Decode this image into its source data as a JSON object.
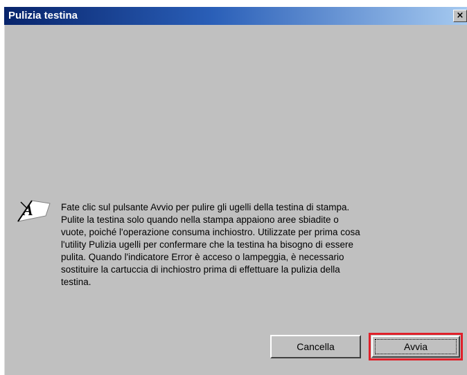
{
  "window": {
    "title": "Pulizia testina",
    "close_label": "×"
  },
  "message": {
    "icon": "head-cleaning-info-icon",
    "lines": [
      "Fate clic sul pulsante Avvio per pulire gli ugelli della testina di stampa.",
      "Pulite la testina solo quando nella stampa appaiono aree sbiadite o",
      "vuote, poiché l'operazione consuma inchiostro. Utilizzate per prima cosa",
      "l'utility Pulizia ugelli per confermare che la testina ha bisogno di essere",
      "pulita. Quando l'indicatore Error è acceso o lampeggia, è necessario",
      "sostituire la cartuccia di inchiostro prima di effettuare la pulizia della",
      "testina."
    ]
  },
  "buttons": {
    "cancel_label": "Cancella",
    "start_label": "Avvia"
  },
  "colors": {
    "title_bar_start": "#08246b",
    "title_bar_end": "#a6caf0",
    "dialog_face": "#c0c0c0",
    "highlight_border": "#e0202a"
  }
}
